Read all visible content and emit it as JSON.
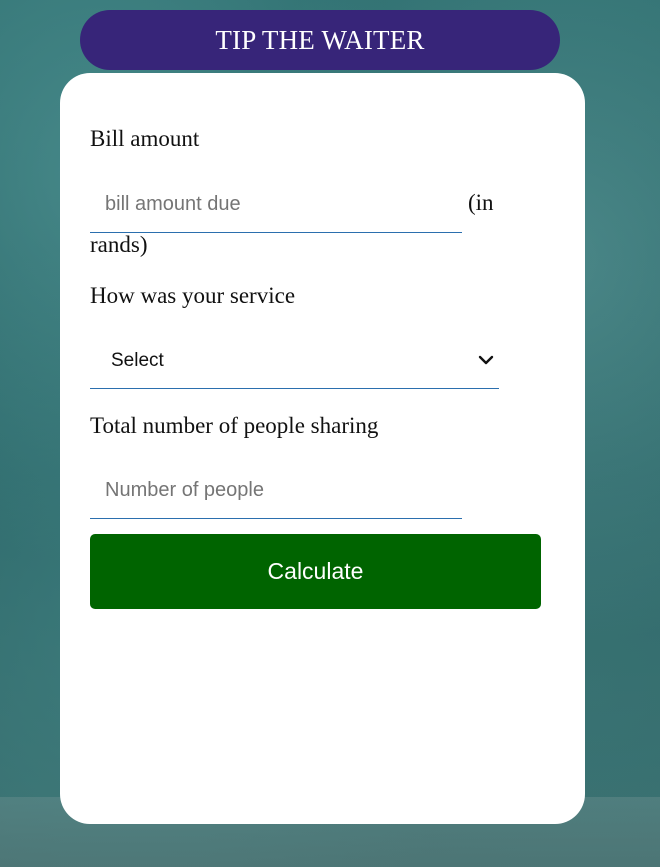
{
  "header": {
    "title": "TIP THE WAITER"
  },
  "form": {
    "bill": {
      "label": "Bill amount",
      "placeholder": "bill amount due",
      "unit_part1": "(in",
      "unit_part2": "rands)"
    },
    "service": {
      "label": "How was your service",
      "selected": "Select"
    },
    "people": {
      "label": "Total number of people sharing",
      "placeholder": "Number of people"
    },
    "calculate_label": "Calculate"
  },
  "colors": {
    "header_bg": "#372579",
    "button_bg": "#006400",
    "input_underline": "#2b6fae"
  },
  "icons": {
    "select_arrow": "chevron-down-icon"
  }
}
